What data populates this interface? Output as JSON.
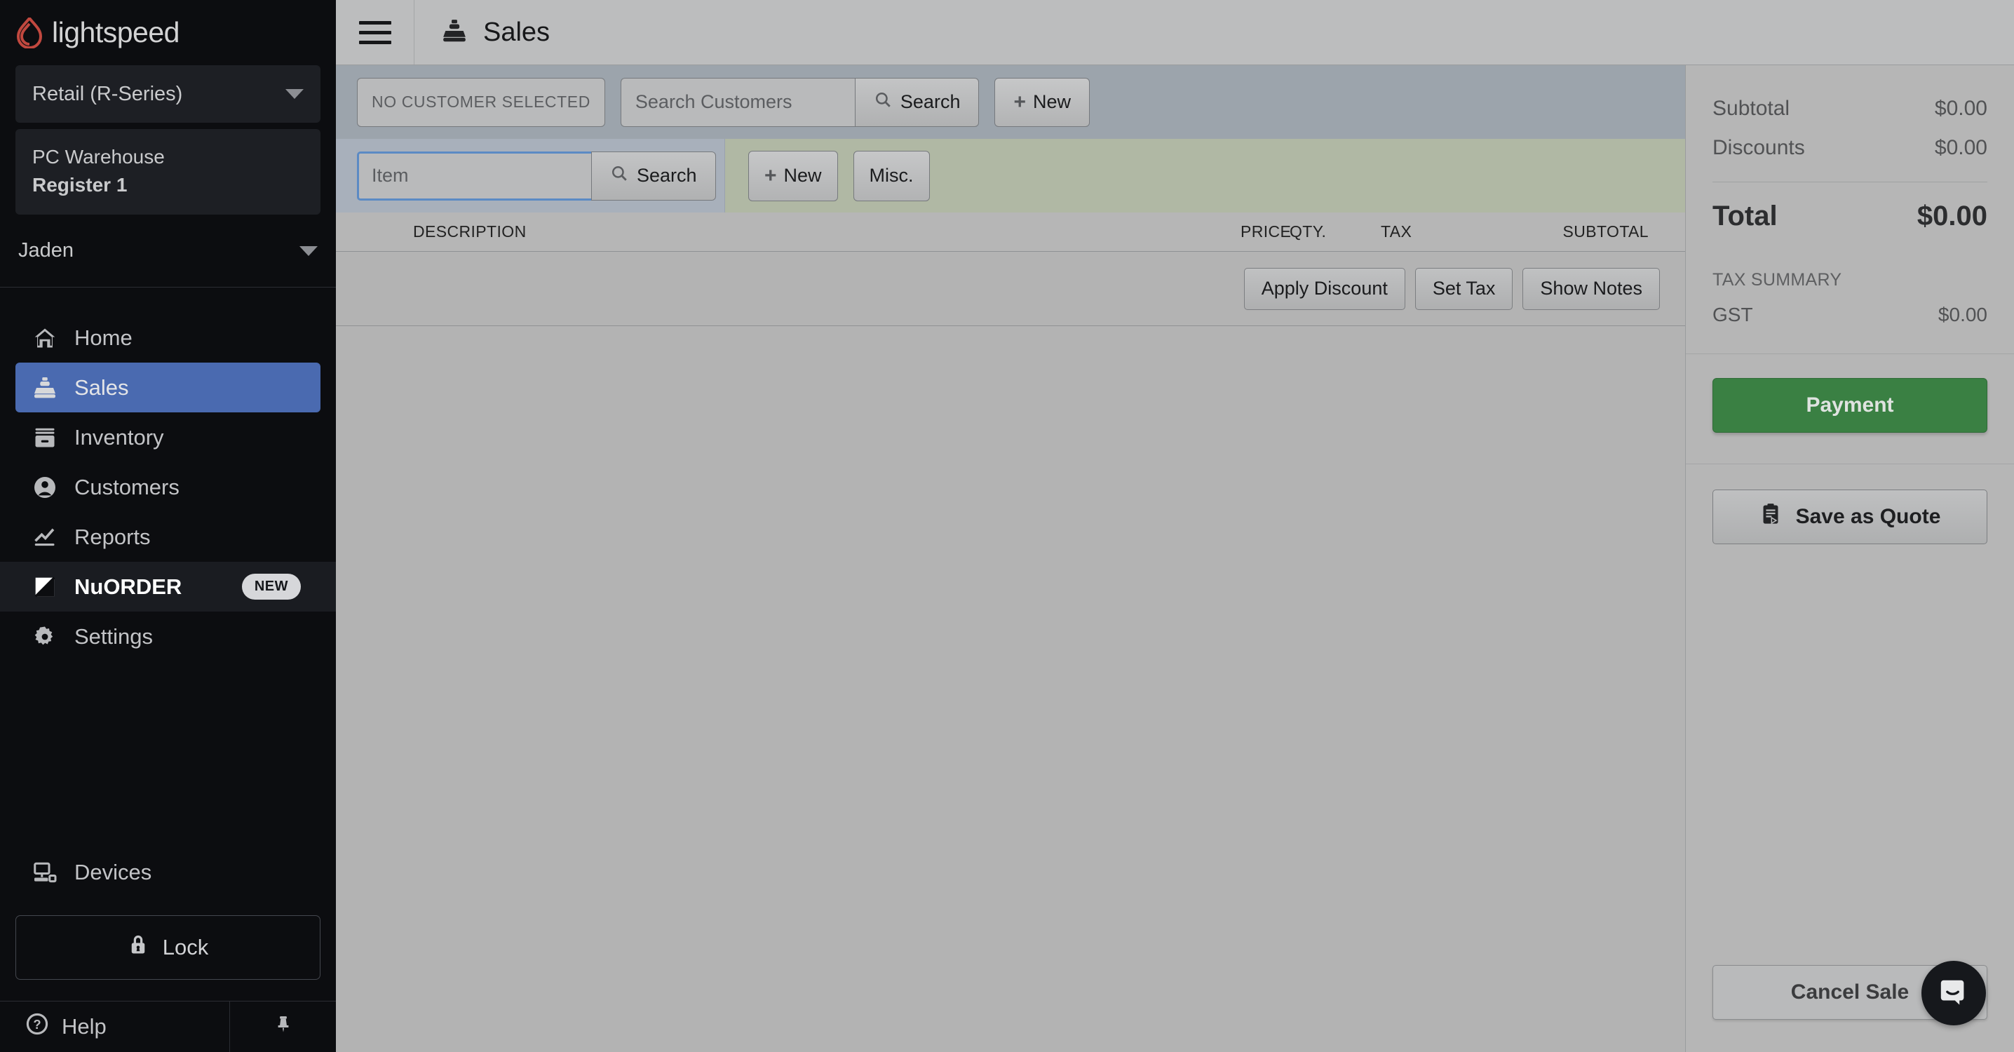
{
  "brand": {
    "name": "lightspeed",
    "accent": "#c1483f"
  },
  "sidebar": {
    "store_selector": {
      "label": "Retail (R-Series)",
      "icon": "chevron-down-icon"
    },
    "register": {
      "location": "PC Warehouse",
      "register": "Register 1"
    },
    "user": {
      "name": "Jaden",
      "icon": "chevron-down-icon"
    },
    "nav": [
      {
        "label": "Home",
        "icon": "home-icon",
        "active": false
      },
      {
        "label": "Sales",
        "icon": "register-icon",
        "active": true
      },
      {
        "label": "Inventory",
        "icon": "inventory-icon",
        "active": false
      },
      {
        "label": "Customers",
        "icon": "user-circle-icon",
        "active": false
      },
      {
        "label": "Reports",
        "icon": "chart-line-icon",
        "active": false
      },
      {
        "label": "NuORDER",
        "icon": "nuorder-icon",
        "active": false,
        "badge": "NEW"
      },
      {
        "label": "Settings",
        "icon": "gear-icon",
        "active": false
      }
    ],
    "devices": {
      "label": "Devices",
      "icon": "devices-icon"
    },
    "lock": {
      "label": "Lock",
      "icon": "lock-icon"
    },
    "help": {
      "label": "Help",
      "icon": "help-circle-icon"
    },
    "pin": {
      "icon": "pin-icon"
    }
  },
  "header": {
    "menu_icon": "hamburger-icon",
    "title": "Sales",
    "title_icon": "register-icon"
  },
  "customer_bar": {
    "no_customer_label": "NO CUSTOMER SELECTED",
    "search_placeholder": "Search Customers",
    "search_value": "",
    "search_button": "Search",
    "new_button": "New"
  },
  "item_bar": {
    "item_placeholder": "Item",
    "item_value": "",
    "search_button": "Search",
    "new_button": "New",
    "misc_button": "Misc."
  },
  "line_table": {
    "columns": [
      "DESCRIPTION",
      "PRICE",
      "QTY.",
      "TAX",
      "SUBTOTAL"
    ],
    "rows": []
  },
  "line_actions": {
    "apply_discount": "Apply Discount",
    "set_tax": "Set Tax",
    "show_notes": "Show Notes"
  },
  "totals": {
    "subtotal_label": "Subtotal",
    "subtotal_value": "$0.00",
    "discounts_label": "Discounts",
    "discounts_value": "$0.00",
    "total_label": "Total",
    "total_value": "$0.00",
    "tax_summary_label": "TAX SUMMARY",
    "tax_lines": [
      {
        "label": "GST",
        "value": "$0.00"
      }
    ],
    "gst_label": "GST",
    "gst_value": "$0.00"
  },
  "right_actions": {
    "payment": "Payment",
    "payment_color": "#3a8043",
    "save_as_quote": "Save as Quote",
    "save_as_quote_icon": "clipboard-icon",
    "cancel_sale": "Cancel Sale"
  },
  "chat": {
    "icon": "chat-bubble-icon"
  }
}
